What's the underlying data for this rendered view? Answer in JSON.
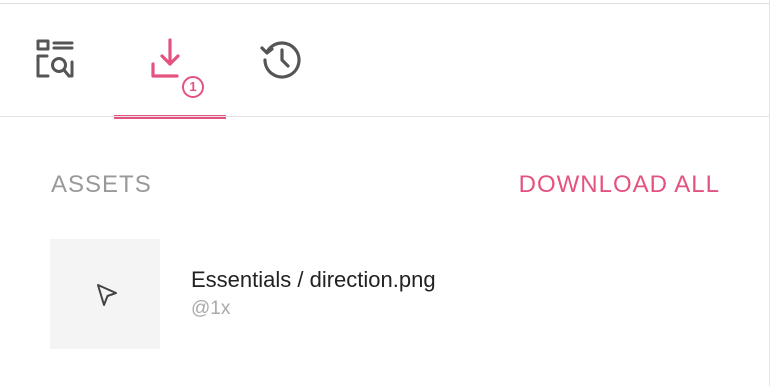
{
  "tabs": [
    {
      "id": "inspect",
      "icon": "inspect-icon",
      "active": false
    },
    {
      "id": "export",
      "icon": "download-icon",
      "active": true,
      "badge": "1"
    },
    {
      "id": "history",
      "icon": "history-icon",
      "active": false
    }
  ],
  "colors": {
    "accent": "#e4527f",
    "muted_text": "#999999",
    "primary_text": "#222222",
    "thumbnail_bg": "#f4f4f4",
    "icon": "#555555"
  },
  "assets_section": {
    "title": "ASSETS",
    "download_all_label": "DOWNLOAD ALL",
    "items": [
      {
        "name": "Essentials / direction.png",
        "scale": "@1x",
        "icon": "cursor-arrow-icon"
      }
    ]
  }
}
